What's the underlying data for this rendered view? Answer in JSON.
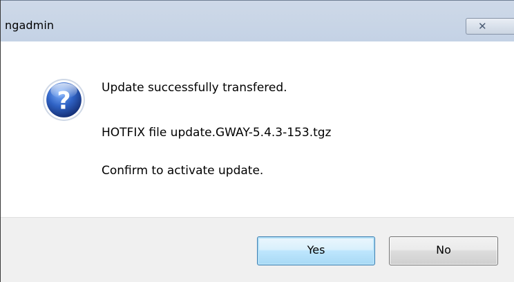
{
  "window": {
    "title": "ngadmin",
    "close_icon": "close-icon"
  },
  "message": {
    "icon": "question-icon",
    "line1": "Update successfully transfered.",
    "line2": "HOTFIX file update.GWAY-5.4.3-153.tgz",
    "line3": "Confirm to activate update."
  },
  "buttons": {
    "yes_label": "Yes",
    "no_label": "No"
  },
  "colors": {
    "titlebar": "#c9d6e8",
    "button_bar": "#f0f0f0",
    "default_button_border": "#3c7fb1",
    "icon_blue": "#1f4fa0"
  }
}
